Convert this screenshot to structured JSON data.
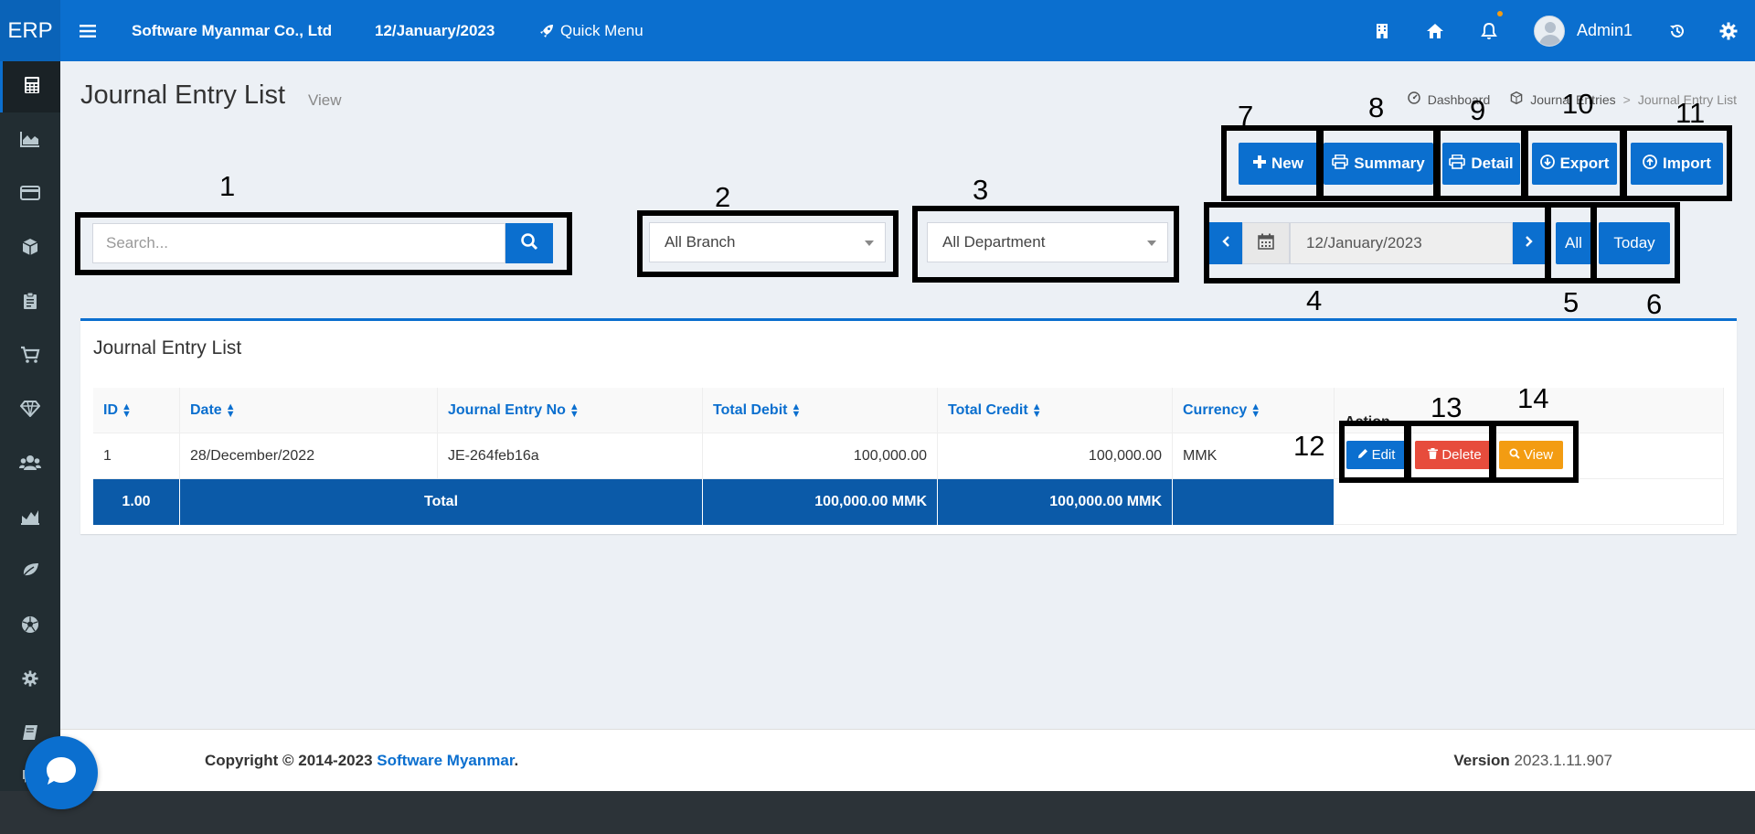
{
  "colors": {
    "primary": "#0b6fcf",
    "sidebar": "#222d32",
    "delete": "#e74c3c",
    "view": "#f39c12",
    "footer_total": "#0b5aa8"
  },
  "header": {
    "brand": "ERP",
    "company": "Software Myanmar Co., Ltd",
    "date": "12/January/2023",
    "quick_menu": "Quick Menu",
    "user": "Admin1"
  },
  "sidebar": {
    "items": [
      "calculator-icon",
      "area-chart-icon",
      "credit-card-icon",
      "cube-icon",
      "clipboard-icon",
      "cart-icon",
      "diamond-icon",
      "users-icon",
      "bar-chart-icon",
      "leaf-icon",
      "soccer-ball-icon",
      "gear-icon",
      "book-icon"
    ]
  },
  "page": {
    "title": "Journal Entry List",
    "subtitle": "View"
  },
  "breadcrumb": {
    "dashboard": "Dashboard",
    "journal_entries": "Journal Entries",
    "separator": ">",
    "current": "Journal Entry List"
  },
  "toolbar": {
    "new": "New",
    "summary": "Summary",
    "detail": "Detail",
    "export": "Export",
    "import": "Import"
  },
  "filters": {
    "search_placeholder": "Search...",
    "branch": "All Branch",
    "department": "All Department",
    "date": "12/January/2023",
    "all": "All",
    "today": "Today"
  },
  "table": {
    "title": "Journal Entry List",
    "headers": {
      "id": "ID",
      "date": "Date",
      "entry_no": "Journal Entry No",
      "total_debit": "Total Debit",
      "total_credit": "Total Credit",
      "currency": "Currency",
      "action": "Action"
    },
    "rows": [
      {
        "id": "1",
        "date": "28/December/2022",
        "entry_no": "JE-264feb16a",
        "total_debit": "100,000.00",
        "total_credit": "100,000.00",
        "currency": "MMK"
      }
    ],
    "actions": {
      "edit": "Edit",
      "delete": "Delete",
      "view": "View"
    },
    "totals": {
      "count": "1.00",
      "label": "Total",
      "debit": "100,000.00 MMK",
      "credit": "100,000.00 MMK"
    }
  },
  "callouts": [
    "1",
    "2",
    "3",
    "4",
    "5",
    "6",
    "7",
    "8",
    "9",
    "10",
    "11",
    "12",
    "13",
    "14"
  ],
  "footer": {
    "copyright": "Copyright © 2014-2023",
    "company_link": "Software Myanmar",
    "period": ".",
    "version_label": "Version",
    "version": "2023.1.11.907"
  }
}
